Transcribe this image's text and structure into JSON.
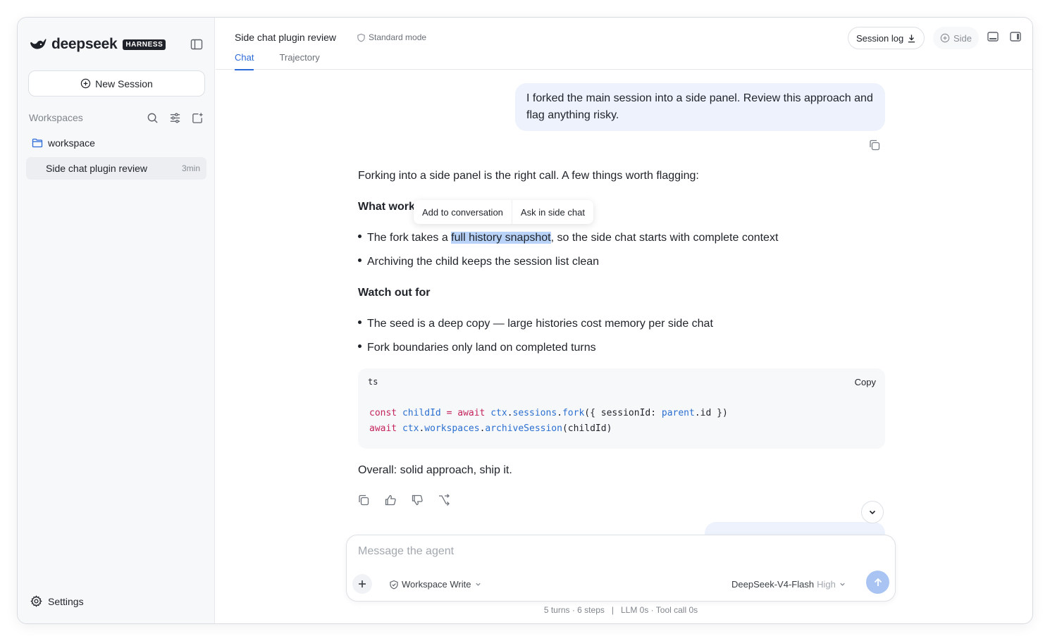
{
  "sidebar": {
    "brand": "deepseek",
    "badge": "HARNESS",
    "new_session_label": "New Session",
    "workspaces_title": "Workspaces",
    "folder_name": "workspace",
    "sessions": [
      {
        "name": "Side chat plugin review",
        "time": "3min"
      }
    ],
    "settings_label": "Settings"
  },
  "header": {
    "title": "Side chat plugin review",
    "mode": "Standard mode",
    "tabs": [
      {
        "label": "Chat",
        "active": true
      },
      {
        "label": "Trajectory",
        "active": false
      }
    ],
    "session_log_label": "Session log",
    "side_label": "Side"
  },
  "chat": {
    "user_message": "I forked the main session into a side panel. Review this approach and flag anything risky.",
    "intro": "Forking into a side panel is the right call. A few things worth flagging:",
    "section1_title": "What works",
    "section1_title_visible": "What work",
    "bullet1_pre": "The fork takes a ",
    "bullet1_highlight": "full history snapshot",
    "bullet1_post": ", so the side chat starts with complete context",
    "bullet2": "Archiving the child keeps the session list clean",
    "section2_title": "Watch out for",
    "bullet3": "The seed is a deep copy — large histories cost memory per side chat",
    "bullet4": "Fork boundaries only land on completed turns",
    "code": {
      "lang": "ts",
      "copy_label": "Copy",
      "line1": [
        "const",
        "childId",
        "=",
        "await",
        "ctx",
        "sessions",
        "fork",
        "({ sessionId: ",
        "parent",
        ".id })"
      ],
      "line2": [
        "await",
        "ctx",
        "workspaces",
        "archiveSession",
        "(childId)"
      ]
    },
    "conclusion": "Overall: solid approach, ship it."
  },
  "selection_popover": {
    "add_label": "Add to conversation",
    "ask_label": "Ask in side chat"
  },
  "composer": {
    "placeholder": "Message the agent",
    "permission": "Workspace Write",
    "model": "DeepSeek-V4-Flash",
    "effort": "High"
  },
  "stats": "5 turns · 6 steps   |   LLM 0s · Tool call 0s",
  "colors": {
    "accent": "#2d6bd9",
    "user_bubble": "#edf2fc",
    "highlight": "#b8d3f7",
    "keyword": "#c4245c",
    "identifier": "#2b6fd0"
  }
}
